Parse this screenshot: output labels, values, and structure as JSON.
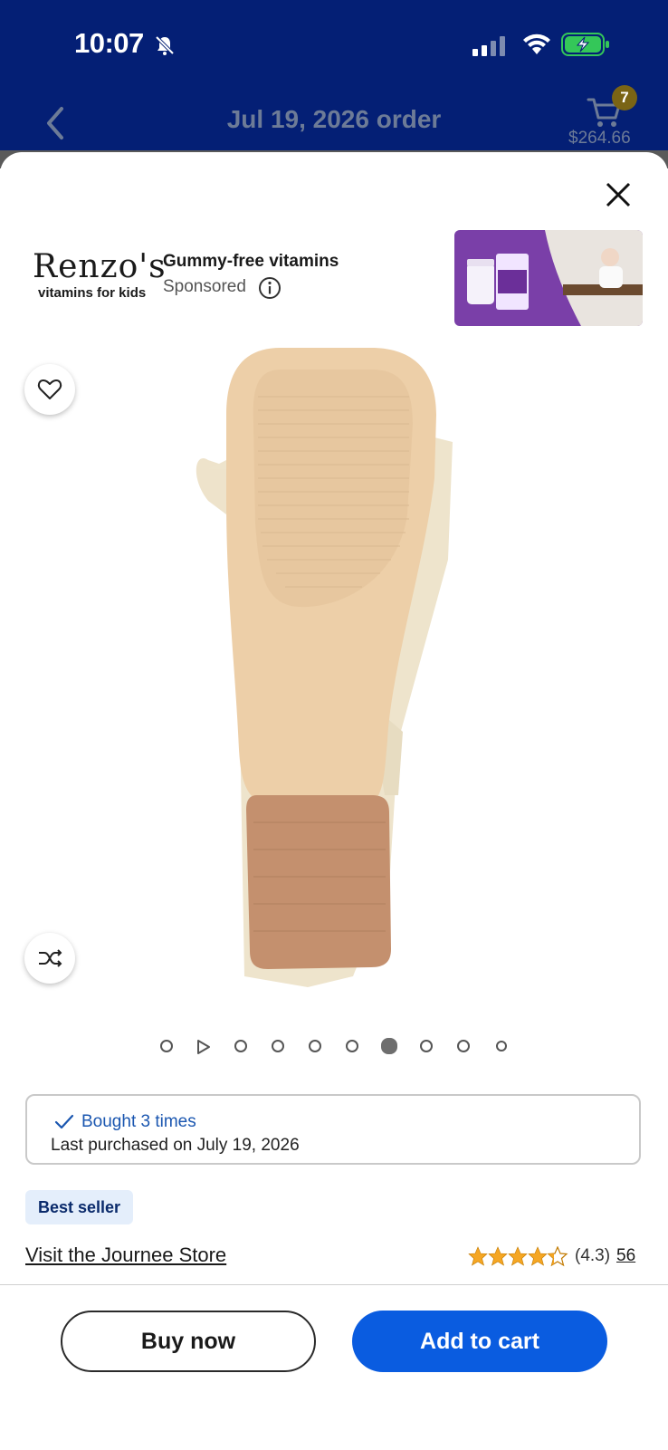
{
  "status": {
    "time": "10:07"
  },
  "header": {
    "title": "Jul 19, 2026 order",
    "cart_count": "7",
    "cart_total": "$264.66"
  },
  "ad": {
    "brand_name": "Renzo's",
    "brand_tagline": "vitamins for kids",
    "title": "Gummy-free vitamins",
    "sponsored": "Sponsored"
  },
  "carousel": {
    "dot_count": 10,
    "active_index": 6
  },
  "purchase_history": {
    "bought": "Bought 3 times",
    "last_purchased": "Last purchased on July 19, 2026"
  },
  "product": {
    "badge": "Best seller",
    "store_link": "Visit the Journee Store",
    "rating": "(4.3)",
    "review_count": "56",
    "stars_value": 4.3
  },
  "actions": {
    "buy_now": "Buy now",
    "add_to_cart": "Add to cart"
  },
  "colors": {
    "header_bg": "#041f75",
    "primary": "#0a5ce0",
    "star": "#f5a623"
  }
}
